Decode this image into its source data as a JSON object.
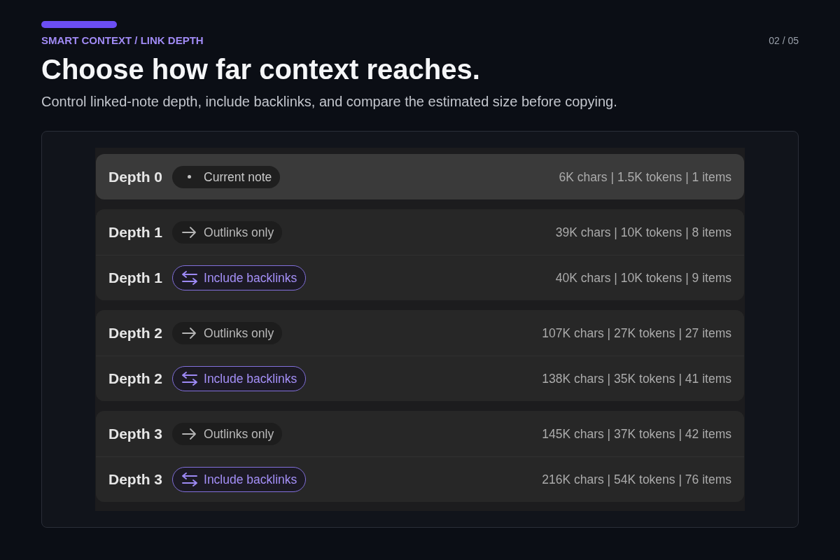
{
  "header": {
    "eyebrow": "SMART CONTEXT / LINK DEPTH",
    "page_counter": "02 / 05",
    "title": "Choose how far context reaches.",
    "subtitle": "Control linked-note depth, include backlinks, and compare the estimated size before copying."
  },
  "depth_groups": [
    {
      "rows": [
        {
          "depth": "Depth 0",
          "mode": {
            "kind": "current",
            "label": "Current note"
          },
          "stats": "6K chars | 1.5K tokens | 1 items",
          "selected": true
        }
      ]
    },
    {
      "rows": [
        {
          "depth": "Depth 1",
          "mode": {
            "kind": "outlinks",
            "label": "Outlinks only"
          },
          "stats": "39K chars | 10K tokens | 8 items",
          "selected": false
        },
        {
          "depth": "Depth 1",
          "mode": {
            "kind": "backlinks",
            "label": "Include backlinks"
          },
          "stats": "40K chars | 10K tokens | 9 items",
          "selected": false
        }
      ]
    },
    {
      "rows": [
        {
          "depth": "Depth 2",
          "mode": {
            "kind": "outlinks",
            "label": "Outlinks only"
          },
          "stats": "107K chars | 27K tokens | 27 items",
          "selected": false
        },
        {
          "depth": "Depth 2",
          "mode": {
            "kind": "backlinks",
            "label": "Include backlinks"
          },
          "stats": "138K chars | 35K tokens | 41 items",
          "selected": false
        }
      ]
    },
    {
      "rows": [
        {
          "depth": "Depth 3",
          "mode": {
            "kind": "outlinks",
            "label": "Outlinks only"
          },
          "stats": "145K chars | 37K tokens | 42 items",
          "selected": false
        },
        {
          "depth": "Depth 3",
          "mode": {
            "kind": "backlinks",
            "label": "Include backlinks"
          },
          "stats": "216K chars | 54K tokens | 76 items",
          "selected": false
        }
      ]
    }
  ]
}
